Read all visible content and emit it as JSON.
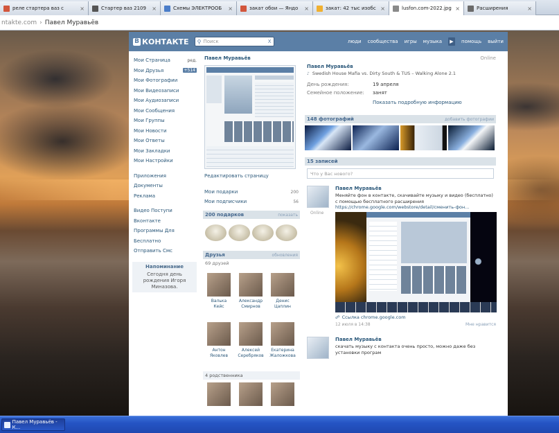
{
  "browser": {
    "tabs": [
      {
        "label": "реле стартера ваз с",
        "icon_color": "#d2563c",
        "active": false
      },
      {
        "label": "Стартер ваз 2109",
        "icon_color": "#555555",
        "active": false
      },
      {
        "label": "Схемы ЭЛЕКТРООБ",
        "icon_color": "#4a7dc9",
        "active": false
      },
      {
        "label": "закат обои — Яндо",
        "icon_color": "#d2563c",
        "active": false
      },
      {
        "label": "закат: 42 тыс изобс",
        "icon_color": "#f0b030",
        "active": false
      },
      {
        "label": "lusfon.com-2022.jpg",
        "icon_color": "#8a8a8a",
        "active": false
      },
      {
        "label": "Расширения",
        "icon_color": "#6a6a6a",
        "active": false
      }
    ],
    "address_domain": "ntakte.com",
    "address_separator": "›",
    "address_page": "Павел Муравьёв"
  },
  "vk": {
    "logo_letter": "B",
    "logo_text": "КОНТАКТЕ",
    "search_placeholder": "Поиск",
    "search_clear": "X",
    "nav": [
      "люди",
      "сообщества",
      "игры",
      "музыка",
      "помощь",
      "выйти"
    ],
    "play_icon": "▶",
    "menu": [
      {
        "label": "Мои Страница",
        "count": "ред.",
        "badge": false
      },
      {
        "label": "Мои Друзья",
        "count": "+514",
        "badge": true
      },
      {
        "label": "Мои Фотографии",
        "count": "",
        "badge": false
      },
      {
        "label": "Мои Видеозаписи",
        "count": "",
        "badge": false
      },
      {
        "label": "Мои Аудиозаписи",
        "count": "",
        "badge": false
      },
      {
        "label": "Мои Сообщения",
        "count": "",
        "badge": false
      },
      {
        "label": "Мои Группы",
        "count": "",
        "badge": false
      },
      {
        "label": "Мои Новости",
        "count": "",
        "badge": false
      },
      {
        "label": "Мои Ответы",
        "count": "",
        "badge": false
      },
      {
        "label": "Мои Закладки",
        "count": "",
        "badge": false
      },
      {
        "label": "Мои Настройки",
        "count": "",
        "badge": false
      }
    ],
    "menu2": [
      "Приложения",
      "Документы",
      "Реклама"
    ],
    "menu3": [
      "Видео Поступи",
      "Вконтакте",
      "Программы Для",
      "Бесплатно",
      "Отправить Смс"
    ],
    "notice_title": "Напоминание",
    "notice_text": "Сегодня день рождения Игоря Миназова.",
    "profile_header": "Павел Муравьёв",
    "edit_page": "Редактировать страницу",
    "links": [
      {
        "label": "Мои подарки",
        "count": "200"
      },
      {
        "label": "Мои подписчики",
        "count": "56"
      }
    ],
    "gifts_title": "200 подарков",
    "gifts_more": "показать",
    "friends_title": "Друзья",
    "friends_more": "обновления",
    "friends_count": "69 друзей",
    "friends": [
      {
        "line1": "Валька",
        "line2": "Кейс"
      },
      {
        "line1": "Александр",
        "line2": "Смирнов"
      },
      {
        "line1": "Денис",
        "line2": "Цаплин"
      },
      {
        "line1": "Антон",
        "line2": "Яковлев"
      },
      {
        "line1": "Алексей",
        "line2": "Серебряков"
      },
      {
        "line1": "Екатерина",
        "line2": "Жаложкова"
      }
    ],
    "relatives": "4 родственника",
    "online": "Online",
    "name": "Павел Муравьёв",
    "status": "Swedish House Mafia vs. Dirty South & TUS – Walking Alone 2.1",
    "status_note": "♪",
    "info": [
      {
        "key": "День рождения:",
        "value": "19 апреля"
      },
      {
        "key": "Семейное положение:",
        "value": "занят"
      }
    ],
    "more_info": "Показать подробную информацию",
    "photos_title": "148 фотографий",
    "photos_more": "добавить фотографии",
    "wall_title": "15 записей",
    "wall_placeholder": "Что у Вас нового?",
    "posts": [
      {
        "author": "Павел Муравьёв",
        "text": "Меняйте фон в контакте, скачивайте музыку и видео (бесплатно) с помощью бесплатного расширения",
        "url": "https://chrome.google.com/webstore/detail/сменить-фон...",
        "online": "Online",
        "link_icon": "☍",
        "link": "Ссылка chrome.google.com",
        "date": "12 июля в 14:38",
        "likes": "Мне нравится"
      },
      {
        "author": "Павел Муравьёв",
        "text": "скачать музыку с контакта очень просто, можно даже без установки програм"
      }
    ]
  },
  "taskbar": {
    "label": "Павел Муравьёв - К..."
  },
  "colors": {
    "vk_blue": "#5b7fa6",
    "vk_link": "#2b587a",
    "taskbar": "#2554c4"
  }
}
